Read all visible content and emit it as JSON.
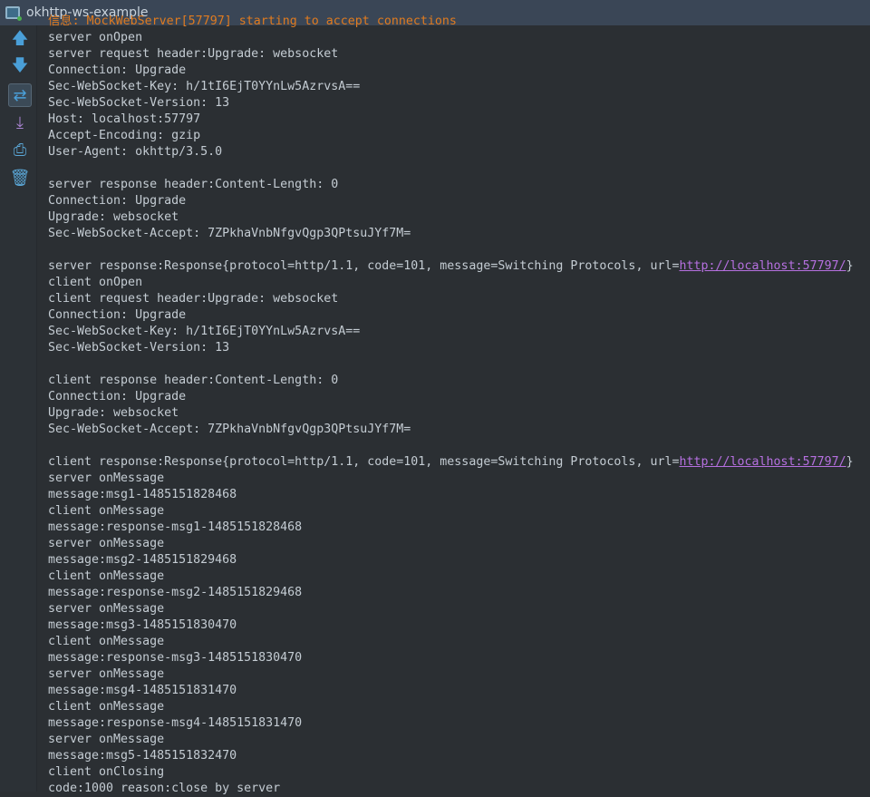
{
  "window": {
    "title": "okhttp-ws-example"
  },
  "toolbar": {
    "items": [
      {
        "name": "scroll-up-icon",
        "glyph": "🡅"
      },
      {
        "name": "scroll-down-icon",
        "glyph": "🡇"
      },
      {
        "name": "soft-wrap-icon",
        "glyph": "⇄"
      },
      {
        "name": "scroll-to-end-icon",
        "glyph": "⤓"
      },
      {
        "name": "print-icon",
        "glyph": "⎙"
      },
      {
        "name": "clear-all-icon",
        "glyph": "🗑"
      }
    ]
  },
  "console": {
    "lines": [
      {
        "text": "信息: MockWebServer[57797] starting to accept connections",
        "type": "info"
      },
      {
        "text": "server onOpen"
      },
      {
        "text": "server request header:Upgrade: websocket"
      },
      {
        "text": "Connection: Upgrade"
      },
      {
        "text": "Sec-WebSocket-Key: h/1tI6EjT0YYnLw5AzrvsA=="
      },
      {
        "text": "Sec-WebSocket-Version: 13"
      },
      {
        "text": "Host: localhost:57797"
      },
      {
        "text": "Accept-Encoding: gzip"
      },
      {
        "text": "User-Agent: okhttp/3.5.0"
      },
      {
        "text": ""
      },
      {
        "text": "server response header:Content-Length: 0"
      },
      {
        "text": "Connection: Upgrade"
      },
      {
        "text": "Upgrade: websocket"
      },
      {
        "text": "Sec-WebSocket-Accept: 7ZPkhaVnbNfgvQgp3QPtsuJYf7M="
      },
      {
        "text": ""
      },
      {
        "text": "server response:Response{protocol=http/1.1, code=101, message=Switching Protocols, url=",
        "link": "http://localhost:57797/",
        "suffix": "}"
      },
      {
        "text": "client onOpen"
      },
      {
        "text": "client request header:Upgrade: websocket"
      },
      {
        "text": "Connection: Upgrade"
      },
      {
        "text": "Sec-WebSocket-Key: h/1tI6EjT0YYnLw5AzrvsA=="
      },
      {
        "text": "Sec-WebSocket-Version: 13"
      },
      {
        "text": ""
      },
      {
        "text": "client response header:Content-Length: 0"
      },
      {
        "text": "Connection: Upgrade"
      },
      {
        "text": "Upgrade: websocket"
      },
      {
        "text": "Sec-WebSocket-Accept: 7ZPkhaVnbNfgvQgp3QPtsuJYf7M="
      },
      {
        "text": ""
      },
      {
        "text": "client response:Response{protocol=http/1.1, code=101, message=Switching Protocols, url=",
        "link": "http://localhost:57797/",
        "suffix": "}"
      },
      {
        "text": "server onMessage"
      },
      {
        "text": "message:msg1-1485151828468"
      },
      {
        "text": "client onMessage"
      },
      {
        "text": "message:response-msg1-1485151828468"
      },
      {
        "text": "server onMessage"
      },
      {
        "text": "message:msg2-1485151829468"
      },
      {
        "text": "client onMessage"
      },
      {
        "text": "message:response-msg2-1485151829468"
      },
      {
        "text": "server onMessage"
      },
      {
        "text": "message:msg3-1485151830470"
      },
      {
        "text": "client onMessage"
      },
      {
        "text": "message:response-msg3-1485151830470"
      },
      {
        "text": "server onMessage"
      },
      {
        "text": "message:msg4-1485151831470"
      },
      {
        "text": "client onMessage"
      },
      {
        "text": "message:response-msg4-1485151831470"
      },
      {
        "text": "server onMessage"
      },
      {
        "text": "message:msg5-1485151832470"
      },
      {
        "text": "client onClosing"
      },
      {
        "text": "code:1000 reason:close by server"
      }
    ]
  },
  "colors": {
    "info": "#e07b1f",
    "link": "#b670e0",
    "text": "#c4ccd3",
    "background": "#2b2f33"
  }
}
